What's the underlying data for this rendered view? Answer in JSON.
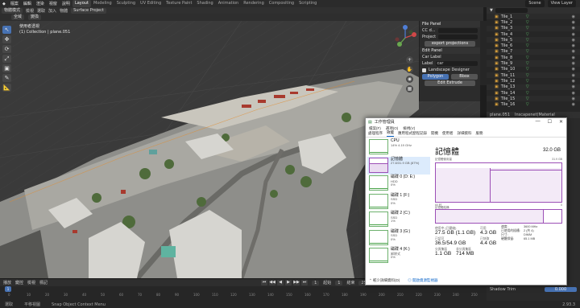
{
  "topbar": {
    "menus": [
      "檔案",
      "編輯",
      "渲染",
      "視窗",
      "說明"
    ],
    "workspaces": [
      "Layout",
      "Modeling",
      "Sculpting",
      "UV Editing",
      "Texture Paint",
      "Shading",
      "Animation",
      "Rendering",
      "Compositing",
      "Scripting"
    ],
    "active_workspace": "Layout",
    "scene": "Scene",
    "view_layer": "View Layer"
  },
  "viewport_header": {
    "mode": "物體模式",
    "menus": [
      "檢視",
      "選取",
      "加入",
      "物體"
    ],
    "addon": "Surface Project",
    "transform_dropdown": "全域",
    "pivot_dropdown": "變換"
  },
  "viewport": {
    "view_name": "使用者透視",
    "collection_info": "(1) Collection | plane.051",
    "tools": [
      "↖",
      "✥",
      "⟳",
      "⤢",
      "▣",
      "✎",
      "📐"
    ]
  },
  "npanel": {
    "file_panel_title": "File Panel",
    "cc_label": "CC d...",
    "project_label": "Project",
    "export_button": "export projections",
    "edit_panel_title": "Edit Panel",
    "car_label_label": "Car Label",
    "label_label": "Label",
    "label_value": "car",
    "landscape_designer_label": "Landscape Designer",
    "button_a": "Polygon",
    "button_b": "Bbox",
    "edit_extrude_button": "Edit Extrude"
  },
  "outliner": {
    "items": [
      "Tile_1",
      "Tile_2",
      "Tile_3",
      "Tile_4",
      "Tile_5",
      "Tile_6",
      "Tile_7",
      "Tile_8",
      "Tile_9",
      "Tile_10",
      "Tile_11",
      "Tile_12",
      "Tile_13",
      "Tile_14",
      "Tile_15",
      "Tile_16"
    ]
  },
  "properties": {
    "tabs": [
      "plane.051",
      "Inscapenet(Material"
    ],
    "shadow_trim_label": "Shadow Trim",
    "shadow_trim_value": "0.000"
  },
  "timeline": {
    "menus": [
      "播放",
      "鍵控",
      "檢視",
      "標記"
    ],
    "current_frame": "1",
    "start_label": "起始",
    "start_value": "1",
    "end_label": "結束",
    "end_value": "250"
  },
  "statusbar": {
    "items": [
      "選取",
      "平移視圖",
      "Snap Object Context Menu"
    ],
    "version": "2.93.3"
  },
  "taskmanager": {
    "title": "工作管理員",
    "menus": [
      "檔案(F)",
      "選項(O)",
      "檢視(V)"
    ],
    "tabs": [
      "處理程序",
      "效能",
      "應用程式歷程記錄",
      "開機",
      "使用者",
      "詳細資料",
      "服務"
    ],
    "active_tab": "效能",
    "sidebar": [
      {
        "name": "CPU",
        "sub1": "14% 4.19 GHz",
        "sub2": ""
      },
      {
        "name": "記憶體",
        "sub1": "27.8/31.9 GB (87%)",
        "sub2": ""
      },
      {
        "name": "磁碟 0 (D: E:)",
        "sub1": "HDD",
        "sub2": "0%"
      },
      {
        "name": "磁碟 1 (F:)",
        "sub1": "SSD",
        "sub2": "0%"
      },
      {
        "name": "磁碟 2 (C:)",
        "sub1": "SSD",
        "sub2": "1%"
      },
      {
        "name": "磁碟 3 (G:)",
        "sub1": "SSD",
        "sub2": "0%"
      },
      {
        "name": "磁碟 4 (K:)",
        "sub1": "卸除式",
        "sub2": "0%"
      }
    ],
    "memory_title": "記憶體",
    "capacity": "32.0 GB",
    "graph_label": "記憶體使用量",
    "graph_max": "31.9 GB",
    "graph_time": "60 秒",
    "graph_min": "0",
    "composition_label": "記憶體結構",
    "stats": {
      "in_use_label": "使用中 (已壓縮)",
      "in_use_value": "27.5 GB (1.1 GB)",
      "available_label": "可用",
      "available_value": "4.3 GB",
      "committed_label": "已認可",
      "committed_value": "36.5/54.9 GB",
      "cached_label": "已快取",
      "cached_value": "4.4 GB",
      "paged_label": "分頁集區",
      "paged_value": "1.1 GB",
      "nonpaged_label": "非分頁集區",
      "nonpaged_value": "714 MB"
    },
    "specs": {
      "speed_label": "速度:",
      "speed_value": "3600 MHz",
      "slots_label": "已使用的插槽:",
      "slots_value": "2 (共 4)",
      "form_label": "尺寸:",
      "form_value": "DIMM",
      "reserved_label": "硬體保留:",
      "reserved_value": "65.1 MB"
    },
    "footer_less": "較少詳細資料(D)",
    "footer_link": "開啟資源監視器"
  },
  "colors": {
    "accent": "#4772b3",
    "memory_purple": "#9c4fb6",
    "disk_green": "#4aa34a"
  }
}
